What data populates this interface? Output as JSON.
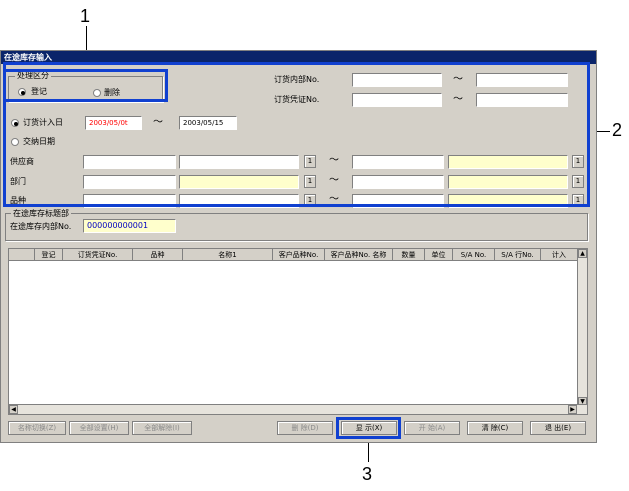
{
  "window": {
    "title": "在途库存输入"
  },
  "process_group": {
    "title": "处理区分",
    "options": [
      {
        "label": "登记",
        "selected": true
      },
      {
        "label": "删除",
        "selected": false
      }
    ]
  },
  "order_internal_no": {
    "label": "订货内部No.",
    "from": "",
    "to": ""
  },
  "order_voucher_no": {
    "label": "订货凭证No.",
    "from": "",
    "to": ""
  },
  "date_mode": {
    "options": [
      {
        "label": "订货计入日",
        "selected": true
      },
      {
        "label": "交纳日期",
        "selected": false
      }
    ],
    "from": "2003/05/0t",
    "to": "2003/05/15"
  },
  "tilde": "～",
  "lookup_label": "1",
  "rows": [
    {
      "label": "供应商"
    },
    {
      "label": "部门"
    },
    {
      "label": "品种"
    }
  ],
  "header_group": {
    "title": "在途库存标题部",
    "field_label": "在途库存内部No.",
    "value": "000000000001"
  },
  "grid": {
    "columns": [
      "",
      "登记",
      "订货凭证No.",
      "品种",
      "名称1",
      "客户品种No.",
      "客户品种No. 名称",
      "数量",
      "单位",
      "S/A No.",
      "S/A 行No.",
      "计入"
    ]
  },
  "buttons": {
    "name_switch": "名称切换(Z)",
    "set_all": "全部设置(H)",
    "clear_all": "全部解除(I)",
    "delete": "删  除(D)",
    "display": "显  示(X)",
    "start": "开  始(A)",
    "clear": "清  除(C)",
    "exit": "退  出(E)"
  },
  "callouts": {
    "one": "1",
    "two": "2",
    "three": "3"
  },
  "colors": {
    "title_bar": "#0a246a",
    "callout_box": "#1040d0",
    "highlight_field": "#ffffcc"
  }
}
